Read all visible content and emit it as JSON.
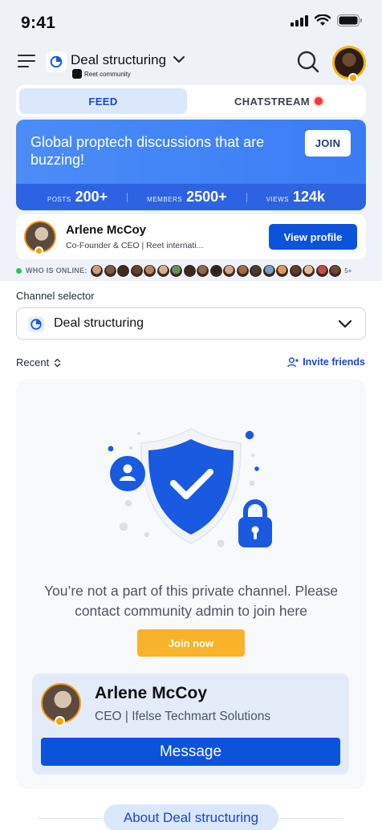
{
  "status_bar": {
    "time": "9:41"
  },
  "header": {
    "channel_name": "Deal structuring",
    "community_name": "Reet community",
    "icons": [
      "menu-icon",
      "channel-logo-icon",
      "chevron-down-icon",
      "search-icon",
      "avatar"
    ]
  },
  "tabs": [
    {
      "label": "FEED",
      "active": true
    },
    {
      "label": "CHATSTREAM",
      "active": false,
      "live_indicator_color": "#f03838"
    }
  ],
  "banner": {
    "headline": "Global proptech discussions that are buzzing!",
    "join_label": "JOIN",
    "stats": [
      {
        "label": "POSTS",
        "value": "200+"
      },
      {
        "label": "MEMBERS",
        "value": "2500+"
      },
      {
        "label": "VIEWS",
        "value": "124k"
      }
    ]
  },
  "profile_card": {
    "name": "Arlene McCoy",
    "role": "Co-Founder & CEO | Reet internati...",
    "button_label": "View profile"
  },
  "online": {
    "label": "WHO IS ONLINE:",
    "more": "5+",
    "face_colors": [
      "#c9a083",
      "#7a5a44",
      "#3b2b22",
      "#5f4536",
      "#b78461",
      "#d5b092",
      "#6b8f5a",
      "#3d2a20",
      "#8d6a52",
      "#2c2420",
      "#caa58c",
      "#a06c4a",
      "#4a3a30",
      "#7a9cc2",
      "#d99a5a",
      "#5a4032",
      "#e3b89a",
      "#c44b4b",
      "#6a4a38"
    ]
  },
  "channel_selector": {
    "label": "Channel selector",
    "value": "Deal structuring"
  },
  "list_controls": {
    "sort_label": "Recent",
    "invite_label": "Invite friends"
  },
  "private_notice": {
    "message": "You’re not a part of this private channel. Please contact community admin to join here",
    "join_label": "Join now"
  },
  "admin_card": {
    "name": "Arlene McCoy",
    "role": "CEO | Ifelse Techmart Solutions",
    "button_label": "Message"
  },
  "about": {
    "label": "About Deal structuring"
  },
  "colors": {
    "primary": "#0c53dc",
    "banner": "#3b7cf5",
    "accent_yellow": "#f8b32a",
    "online_green": "#22c55e"
  }
}
